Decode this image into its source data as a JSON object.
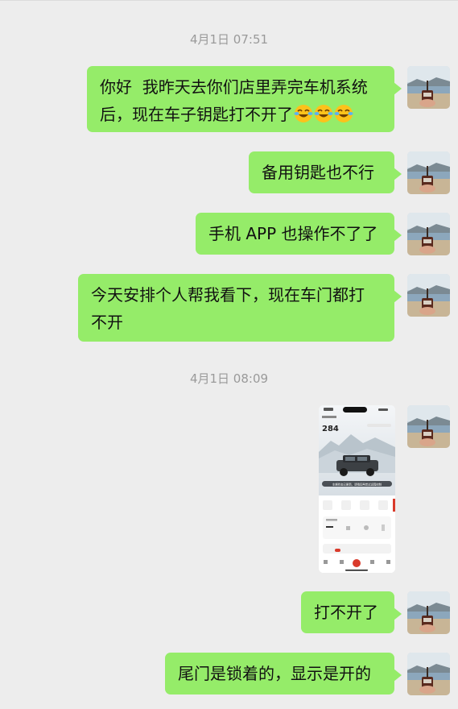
{
  "chat": {
    "timestamps": [
      "4月1日 07:51",
      "4月1日 08:09"
    ],
    "messages": [
      {
        "type": "text",
        "lines": [
          "你好  我昨天去你们店里弄完车机系统",
          "后，现在车子钥匙打不开了"
        ],
        "emoji": [
          "face-with-tears-of-joy-icon",
          "face-with-tears-of-joy-icon",
          "face-with-tears-of-joy-icon"
        ]
      },
      {
        "type": "text",
        "lines": [
          "备用钥匙也不行"
        ]
      },
      {
        "type": "text",
        "lines": [
          "手机 APP 也操作不了了"
        ]
      },
      {
        "type": "text",
        "lines": [
          "今天安排个人帮我看下，现在车门都打",
          "不开"
        ]
      },
      {
        "type": "image",
        "content": {
          "range_value": "284",
          "banner": "车辆状态已更新，请稍后再尝试远程控制"
        }
      },
      {
        "type": "text",
        "lines": [
          "打不开了"
        ]
      },
      {
        "type": "text",
        "lines": [
          "尾门是锁着的，显示是开的"
        ]
      }
    ]
  },
  "colors": {
    "background": "#ededed",
    "sent_bubble": "#95ec69",
    "timestamp_text": "#9a9a9a",
    "message_text": "#111111"
  },
  "icons": {
    "avatar": "beach-photo-avatar-icon",
    "emoji": "face-with-tears-of-joy-icon"
  }
}
